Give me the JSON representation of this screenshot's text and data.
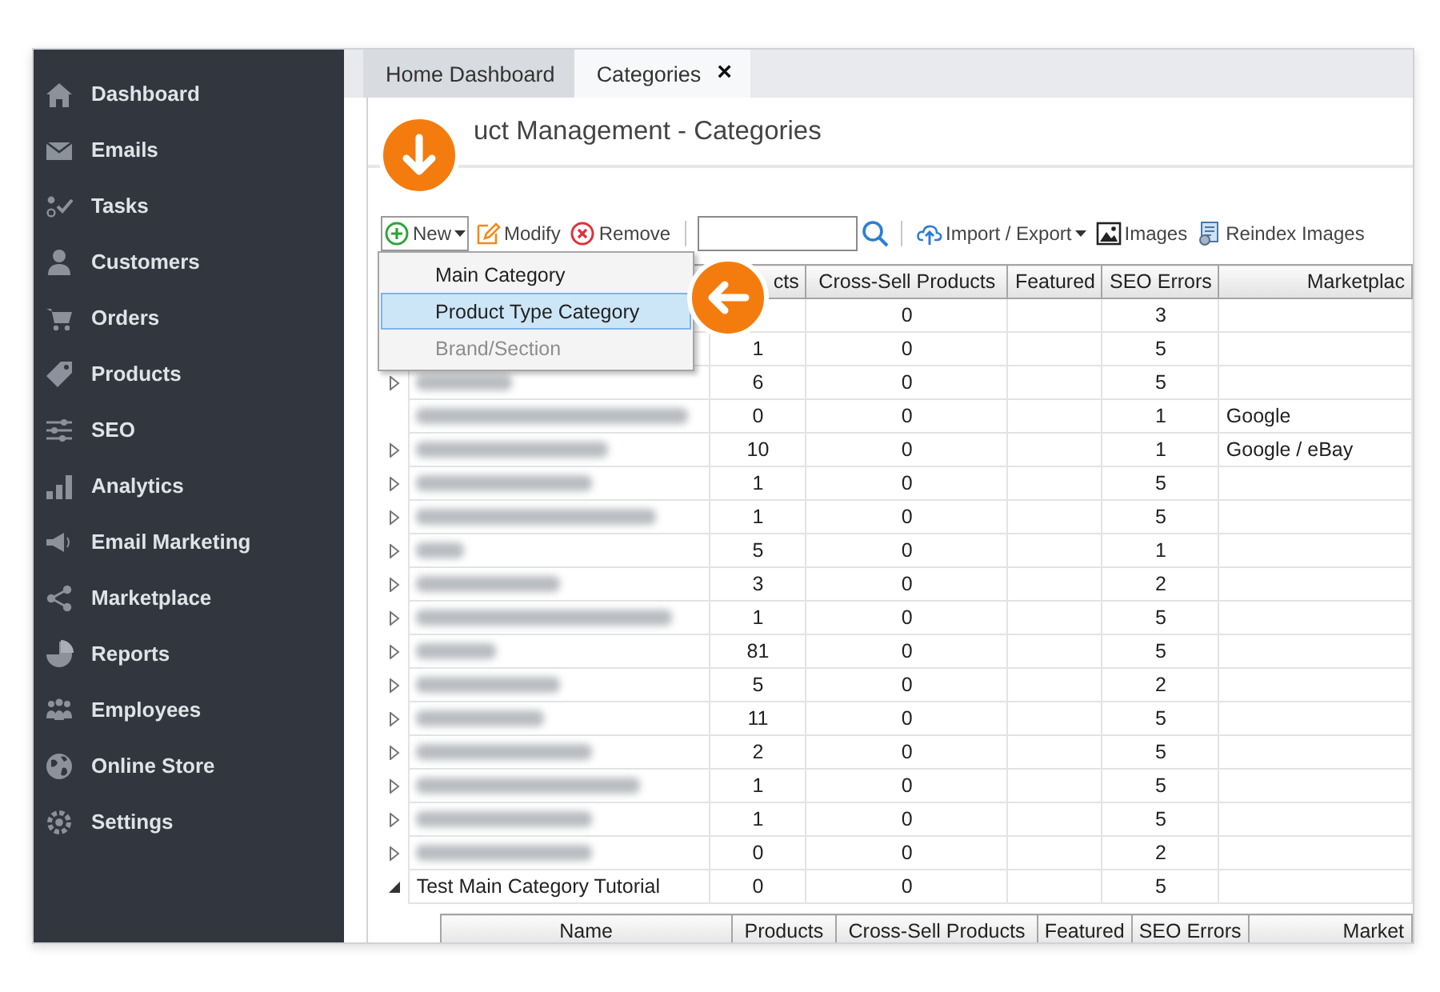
{
  "sidebar": {
    "items": [
      {
        "label": "Dashboard"
      },
      {
        "label": "Emails"
      },
      {
        "label": "Tasks"
      },
      {
        "label": "Customers"
      },
      {
        "label": "Orders"
      },
      {
        "label": "Products"
      },
      {
        "label": "SEO"
      },
      {
        "label": "Analytics"
      },
      {
        "label": "Email Marketing"
      },
      {
        "label": "Marketplace"
      },
      {
        "label": "Reports"
      },
      {
        "label": "Employees"
      },
      {
        "label": "Online Store"
      },
      {
        "label": "Settings"
      }
    ]
  },
  "tabs": [
    {
      "label": "Home Dashboard",
      "selected": false
    },
    {
      "label": "Categories",
      "selected": true,
      "close": "×"
    }
  ],
  "page_title": "uct Management - Categories",
  "toolbar": [
    {
      "kind": "add",
      "label": "New",
      "dropdown": true,
      "open": true
    },
    {
      "kind": "edit",
      "label": "Modify"
    },
    {
      "kind": "remove",
      "label": "Remove"
    },
    {
      "kind": "separator"
    },
    {
      "kind": "search"
    },
    {
      "kind": "separator"
    },
    {
      "kind": "import",
      "label": "Import / Export",
      "dropdown": true,
      "open": false
    },
    {
      "kind": "images",
      "label": "Images"
    },
    {
      "kind": "reindex",
      "label": "Reindex Images"
    }
  ],
  "new_menu": [
    {
      "label": "Main Category",
      "selected": false,
      "disabled": false
    },
    {
      "label": "Product Type Category",
      "selected": true,
      "disabled": false
    },
    {
      "label": "Brand/Section",
      "selected": false,
      "disabled": true
    }
  ],
  "table": {
    "columns": [
      "cts",
      "Cross-Sell Products",
      "Featured",
      "SEO Errors",
      "Marketplac"
    ],
    "rows": [
      {
        "kind": "covered",
        "cross_sell": "0",
        "seo_errors": "3"
      },
      {
        "kind": "covered",
        "products": "1",
        "cross_sell": "0",
        "seo_errors": "5"
      },
      {
        "kind": "blurred",
        "has_children": true,
        "expanded": false,
        "products": "6",
        "cross_sell": "0",
        "seo_errors": "5"
      },
      {
        "kind": "blurred",
        "has_children": false,
        "products": "0",
        "cross_sell": "0",
        "seo_errors": "1",
        "marketplace": "Google"
      },
      {
        "kind": "blurred",
        "has_children": true,
        "expanded": false,
        "products": "10",
        "cross_sell": "0",
        "seo_errors": "1",
        "marketplace": "Google / eBay"
      },
      {
        "kind": "blurred",
        "has_children": true,
        "expanded": false,
        "products": "1",
        "cross_sell": "0",
        "seo_errors": "5"
      },
      {
        "kind": "blurred",
        "has_children": true,
        "expanded": false,
        "products": "1",
        "cross_sell": "0",
        "seo_errors": "5"
      },
      {
        "kind": "blurred",
        "has_children": true,
        "expanded": false,
        "products": "5",
        "cross_sell": "0",
        "seo_errors": "1"
      },
      {
        "kind": "blurred",
        "has_children": true,
        "expanded": false,
        "products": "3",
        "cross_sell": "0",
        "seo_errors": "2"
      },
      {
        "kind": "blurred",
        "has_children": true,
        "expanded": false,
        "products": "1",
        "cross_sell": "0",
        "seo_errors": "5"
      },
      {
        "kind": "blurred",
        "has_children": true,
        "expanded": false,
        "products": "81",
        "cross_sell": "0",
        "seo_errors": "5"
      },
      {
        "kind": "blurred",
        "has_children": true,
        "expanded": false,
        "products": "5",
        "cross_sell": "0",
        "seo_errors": "2"
      },
      {
        "kind": "blurred",
        "has_children": true,
        "expanded": false,
        "products": "11",
        "cross_sell": "0",
        "seo_errors": "5"
      },
      {
        "kind": "blurred",
        "has_children": true,
        "expanded": false,
        "products": "2",
        "cross_sell": "0",
        "seo_errors": "5"
      },
      {
        "kind": "blurred",
        "has_children": true,
        "expanded": false,
        "products": "1",
        "cross_sell": "0",
        "seo_errors": "5"
      },
      {
        "kind": "blurred",
        "has_children": true,
        "expanded": false,
        "products": "1",
        "cross_sell": "0",
        "seo_errors": "5"
      },
      {
        "kind": "blurred",
        "has_children": true,
        "expanded": false,
        "products": "0",
        "cross_sell": "0",
        "seo_errors": "2"
      },
      {
        "kind": "named",
        "name": "Test Main Category Tutorial",
        "has_children": true,
        "expanded": true,
        "products": "0",
        "cross_sell": "0",
        "seo_errors": "5"
      }
    ],
    "child_columns": [
      "Name",
      "Products",
      "Cross-Sell Products",
      "Featured",
      "SEO Errors",
      "Market"
    ]
  }
}
